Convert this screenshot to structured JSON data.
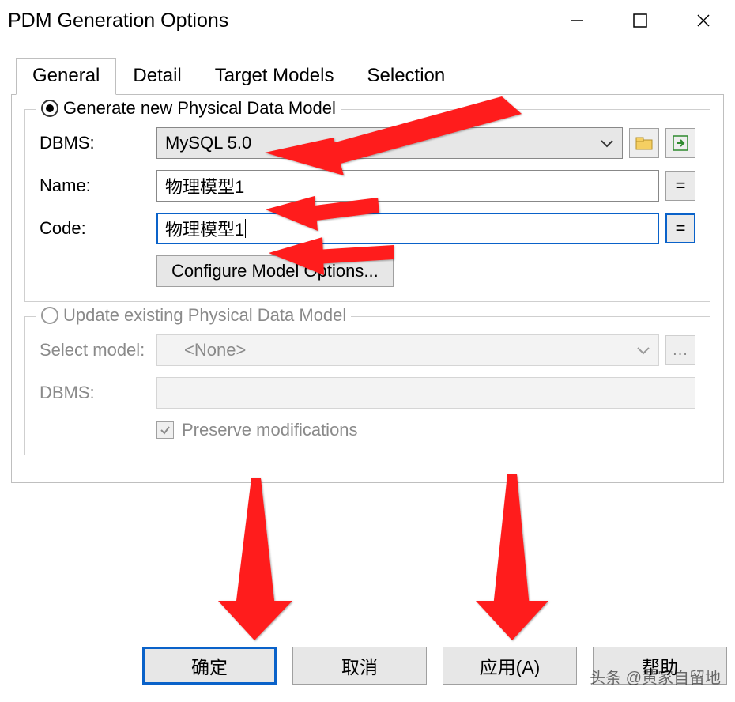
{
  "window": {
    "title": "PDM Generation Options"
  },
  "tabs": {
    "general": "General",
    "detail": "Detail",
    "target_models": "Target Models",
    "selection": "Selection"
  },
  "group_new": {
    "legend": "Generate new Physical Data Model",
    "dbms_label": "DBMS:",
    "dbms_value": "MySQL 5.0",
    "name_label": "Name:",
    "name_value": "物理模型1",
    "code_label": "Code:",
    "code_value": "物理模型1",
    "equals": "=",
    "configure": "Configure Model Options..."
  },
  "group_update": {
    "legend": "Update existing Physical Data Model",
    "select_label": "Select model:",
    "select_value": "<None>",
    "dbms_label": "DBMS:",
    "dbms_value": "",
    "preserve_label": "Preserve modifications",
    "ellipsis": "..."
  },
  "buttons": {
    "ok": "确定",
    "cancel": "取消",
    "apply": "应用(A)",
    "help": "帮助"
  },
  "watermark": "头条 @黄家自留地"
}
